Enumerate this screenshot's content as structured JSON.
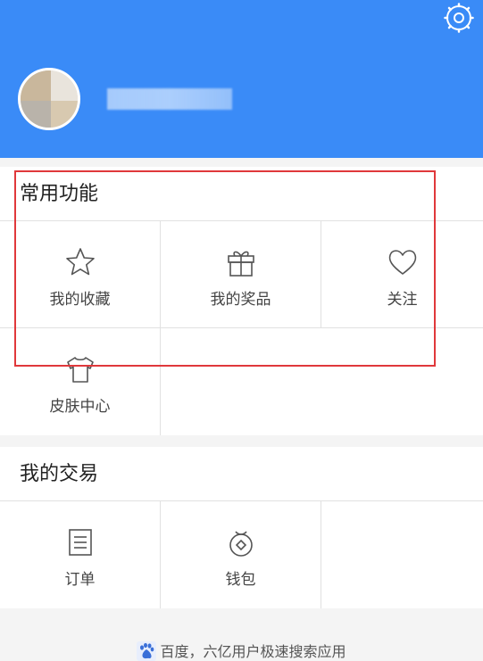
{
  "header": {
    "settings_icon": "settings-icon",
    "accent_color": "#3a8bf7"
  },
  "common": {
    "title": "常用功能",
    "items": [
      {
        "label": "我的收藏",
        "icon": "star-icon"
      },
      {
        "label": "我的奖品",
        "icon": "gift-icon"
      },
      {
        "label": "关注",
        "icon": "heart-icon"
      },
      {
        "label": "皮肤中心",
        "icon": "tshirt-icon"
      }
    ]
  },
  "trade": {
    "title": "我的交易",
    "items": [
      {
        "label": "订单",
        "icon": "order-list-icon"
      },
      {
        "label": "钱包",
        "icon": "wallet-icon"
      }
    ]
  },
  "footer": {
    "text": "百度，六亿用户极速搜索应用",
    "logo": "baidu-paw-icon"
  },
  "highlight_color": "#e0383b"
}
